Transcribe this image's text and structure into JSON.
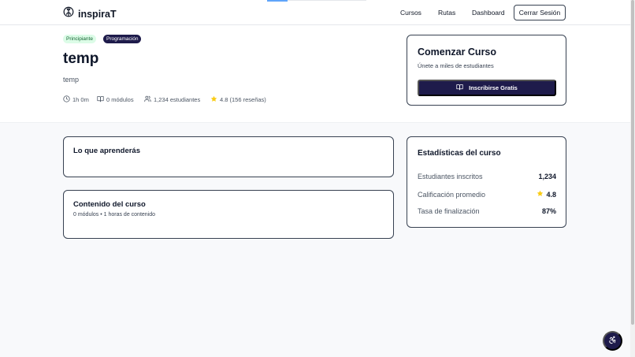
{
  "header": {
    "brand": "inspiraT",
    "nav": [
      "Cursos",
      "Rutas",
      "Dashboard"
    ],
    "logout_label": "Cerrar Sesión"
  },
  "course": {
    "level_badge": "Principiante",
    "category_badge": "Programación",
    "title": "temp",
    "description": "temp",
    "duration": "1h 0m",
    "modules": "0 módulos",
    "students": "1,234 estudiantes",
    "rating": "4.8 (156 reseñas)"
  },
  "enroll": {
    "title": "Comenzar Curso",
    "subtitle": "Únete a miles de estudiantes",
    "button_label": "Inscribirse Gratis"
  },
  "learn": {
    "title": "Lo que aprenderás"
  },
  "content": {
    "title": "Contenido del curso",
    "summary": "0 módulos • 1 horas de contenido"
  },
  "stats": {
    "title": "Estadísticas del curso",
    "rows": [
      {
        "label": "Estudiantes inscritos",
        "value": "1,234"
      },
      {
        "label": "Calificación promedio",
        "value": "4.8"
      },
      {
        "label": "Tasa de finalización",
        "value": "87%"
      }
    ]
  },
  "colors": {
    "primary": "#1e1b4b",
    "star": "#facc15",
    "level_badge_bg": "#dcfce7"
  },
  "icons": {
    "logo": "brain-icon",
    "duration": "clock-icon",
    "modules": "book-open-icon",
    "students": "users-icon",
    "rating": "star-icon",
    "enroll": "book-open-icon",
    "accessibility": "accessibility-icon"
  }
}
